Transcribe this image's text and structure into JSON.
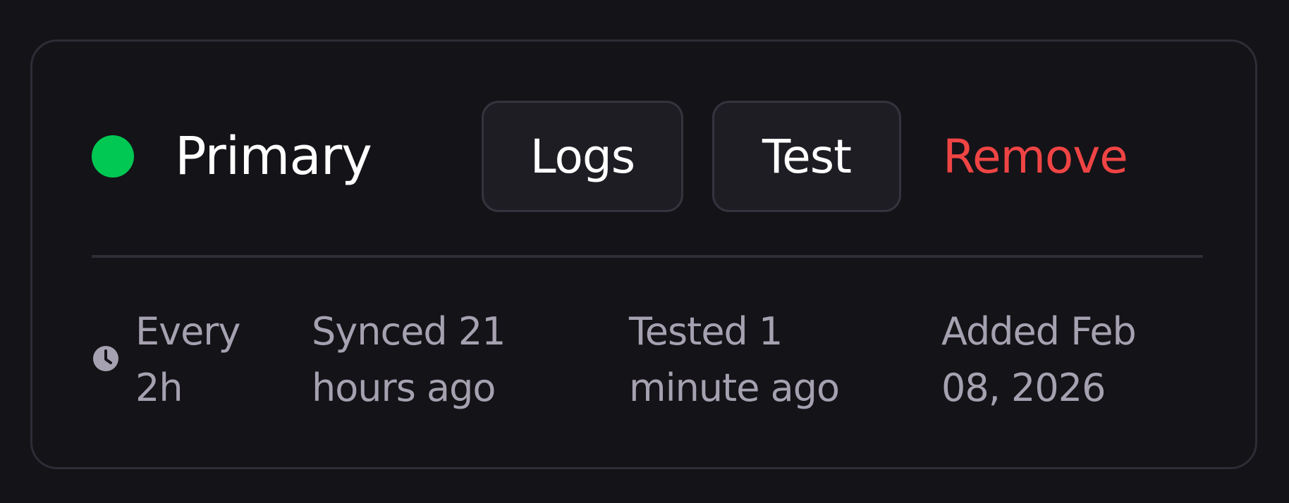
{
  "colors": {
    "status_active": "#00c853",
    "danger": "#ef4444",
    "muted_text": "#a6a1b0"
  },
  "card": {
    "status": "active",
    "title": "Primary",
    "actions": {
      "logs_label": "Logs",
      "test_label": "Test",
      "remove_label": "Remove"
    },
    "meta": {
      "interval_icon": "clock-icon",
      "interval_line1": "Every",
      "interval_line2": "2h",
      "synced_line1": "Synced 21",
      "synced_line2": "hours ago",
      "tested_line1": "Tested 1",
      "tested_line2": "minute ago",
      "added_line1": "Added Feb",
      "added_line2": "08, 2026"
    }
  }
}
